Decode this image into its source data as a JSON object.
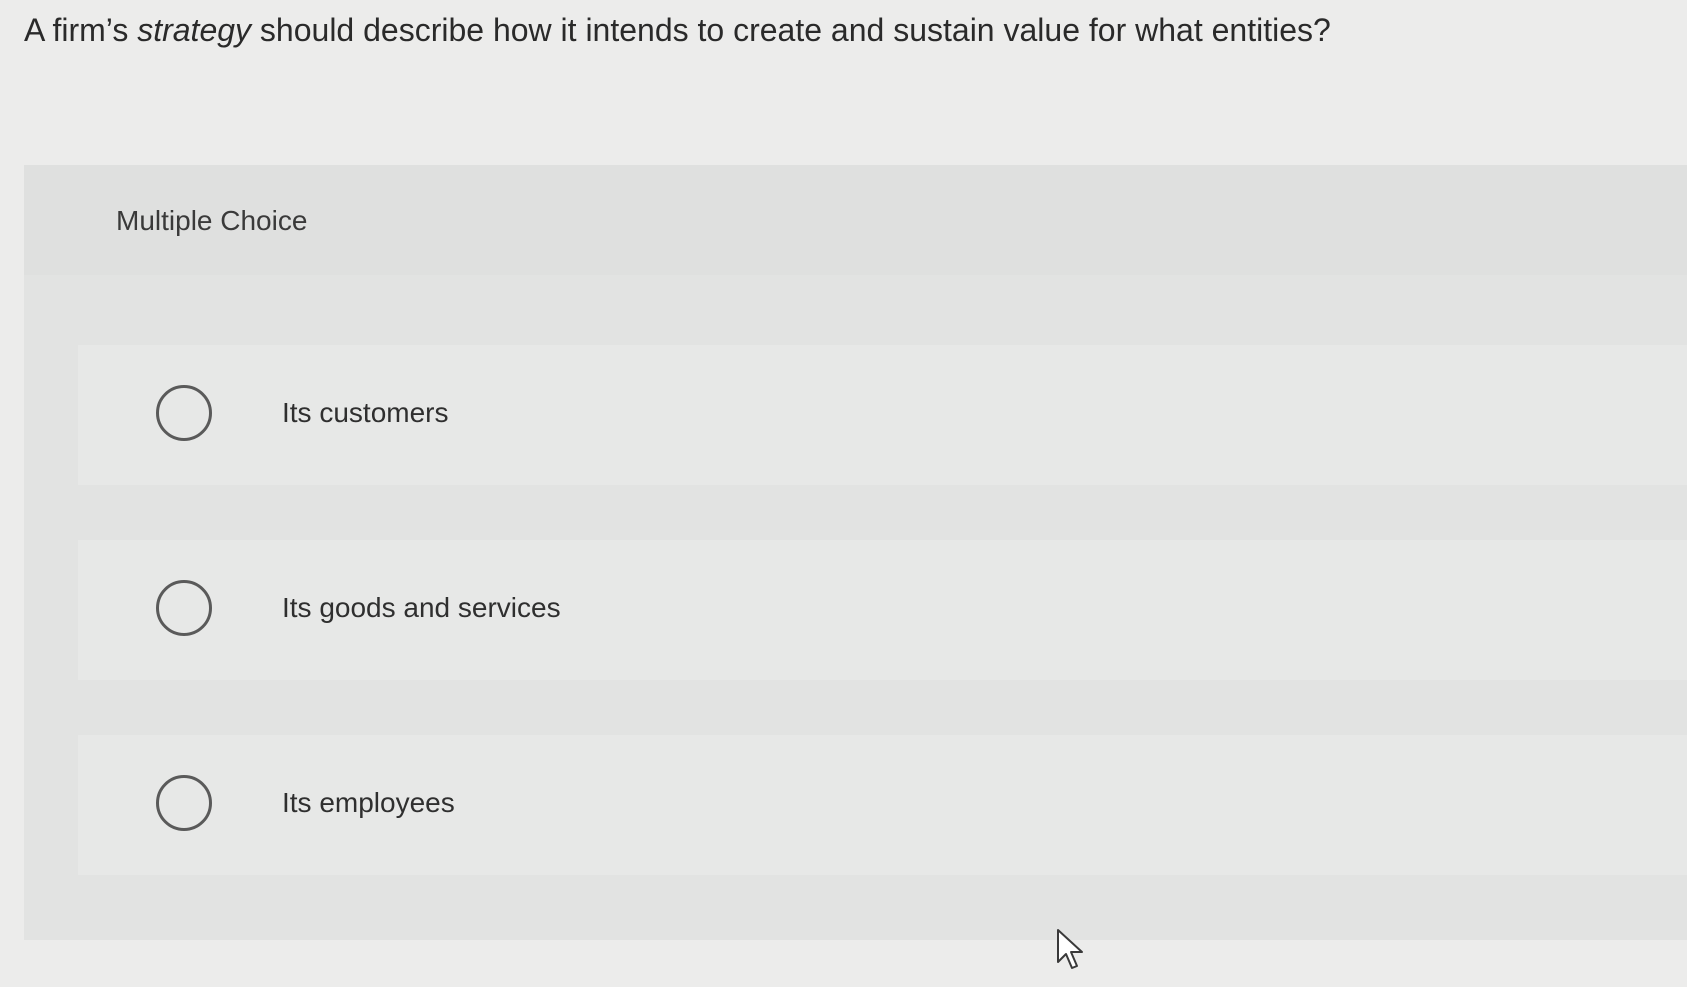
{
  "question": {
    "prefix": "A firm’s ",
    "emphasis": "strategy",
    "suffix": " should describe how it intends to create and sustain value for what entities?"
  },
  "card": {
    "type_label": "Multiple Choice"
  },
  "choices": [
    {
      "label": "Its customers",
      "selected": false
    },
    {
      "label": "Its goods and services",
      "selected": false
    },
    {
      "label": "Its employees",
      "selected": false
    }
  ],
  "icons": {
    "radio": "radio-unselected-icon",
    "cursor": "mouse-pointer-icon"
  }
}
